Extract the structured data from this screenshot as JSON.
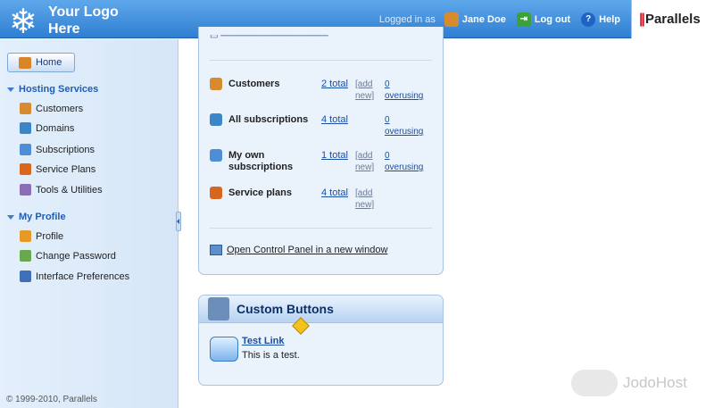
{
  "header": {
    "logo_line1": "Your Logo",
    "logo_line2": "Here",
    "logged_in_as": "Logged in as",
    "user_name": "Jane Doe",
    "logout_label": "Log out",
    "help_label": "Help",
    "brand": "Parallels"
  },
  "sidebar": {
    "home_label": "Home",
    "hosting_services": {
      "title": "Hosting Services",
      "items": [
        {
          "label": "Customers",
          "icon": "customers-icon",
          "color": "#d88a2e"
        },
        {
          "label": "Domains",
          "icon": "domains-icon",
          "color": "#3a86c8"
        },
        {
          "label": "Subscriptions",
          "icon": "subscriptions-icon",
          "color": "#4d8ed6"
        },
        {
          "label": "Service Plans",
          "icon": "service-plans-icon",
          "color": "#d9661f"
        },
        {
          "label": "Tools & Utilities",
          "icon": "tools-icon",
          "color": "#8a6fb4"
        }
      ]
    },
    "my_profile": {
      "title": "My Profile",
      "items": [
        {
          "label": "Profile",
          "icon": "profile-icon",
          "color": "#e59a27"
        },
        {
          "label": "Change Password",
          "icon": "password-icon",
          "color": "#6aa84f"
        },
        {
          "label": "Interface Preferences",
          "icon": "preferences-icon",
          "color": "#3e6fb8"
        }
      ]
    },
    "copyright": "© 1999-2010, Parallels"
  },
  "summary": {
    "rows": [
      {
        "label": "Customers",
        "total": "2 total",
        "add": "[add new]",
        "overusing": "0 overusing",
        "icon": "customers-icon",
        "color": "#d88a2e"
      },
      {
        "label": "All subscriptions",
        "total": "4 total",
        "add": "",
        "overusing": "0 overusing",
        "icon": "subscriptions-icon",
        "color": "#3a86c8"
      },
      {
        "label": "My own subscriptions",
        "total": "1 total",
        "add": "[add new]",
        "overusing": "0 overusing",
        "icon": "own-subscriptions-icon",
        "color": "#4d8ed6"
      },
      {
        "label": "Service plans",
        "total": "4 total",
        "add": "[add new]",
        "overusing": "",
        "icon": "service-plans-icon",
        "color": "#d9661f"
      }
    ],
    "open_cp_label": "Open Control Panel in a new window"
  },
  "custom_buttons": {
    "title": "Custom Buttons",
    "link_label": "Test Link",
    "link_desc": "This is a test."
  },
  "watermark": "JodoHost"
}
